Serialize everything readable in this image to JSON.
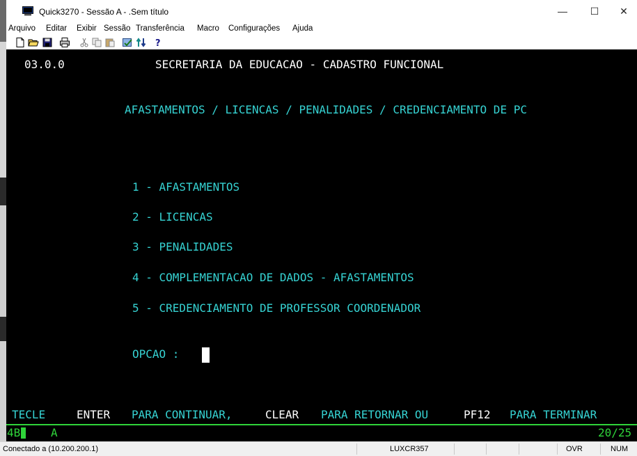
{
  "window": {
    "title": "Quick3270 - Sessão A - .Sem título",
    "minimize_glyph": "—",
    "maximize_glyph": "☐",
    "close_glyph": "✕"
  },
  "menu": [
    "Arquivo",
    "Editar",
    "Exibir",
    "Sessão",
    "Transferência",
    "Macro",
    "Configurações",
    "Ajuda"
  ],
  "toolbar_icons": [
    "new-icon",
    "open-icon",
    "save-icon",
    "print-icon",
    "cut-icon",
    "copy-icon",
    "paste-icon",
    "macro-icon",
    "transfer-icon",
    "help-icon"
  ],
  "terminal": {
    "screen_id": "03.0.0",
    "system_title": "SECRETARIA DA EDUCACAO - CADASTRO FUNCIONAL",
    "subtitle": "AFASTAMENTOS / LICENCAS / PENALIDADES / CREDENCIAMENTO DE PC",
    "options": [
      "1 - AFASTAMENTOS",
      "2 - LICENCAS",
      "3 - PENALIDADES",
      "4 - COMPLEMENTACAO DE DADOS - AFASTAMENTOS",
      "5 - CREDENCIAMENTO DE PROFESSOR COORDENADOR"
    ],
    "prompt_label": "OPCAO :",
    "footer": {
      "w1": "TECLE",
      "w2": "ENTER",
      "w3": "PARA CONTINUAR,",
      "w4": "CLEAR",
      "w5": "PARA RETORNAR OU",
      "w6": "PF12",
      "w7": "PARA TERMINAR"
    },
    "oia": {
      "left": "4B",
      "mode": "A",
      "position": "20/25"
    }
  },
  "statusbar": {
    "connection": "Conectado a  (10.200.200.1)",
    "lu_name": "LUXCR357",
    "insert_mode": "OVR",
    "num_lock": "NUM"
  },
  "colors": {
    "terminal_bg": "#000000",
    "text_white": "#ffffff",
    "text_cyan": "#36d3d3",
    "text_green": "#2fd43a"
  }
}
